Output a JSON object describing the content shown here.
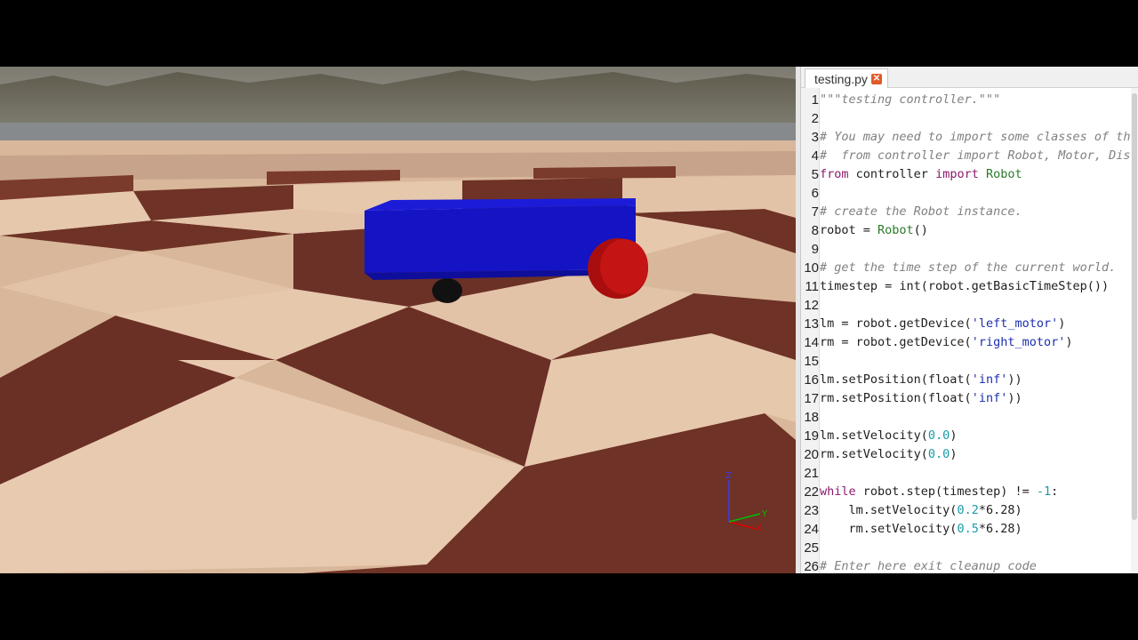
{
  "editor": {
    "tab_label": "testing.py",
    "tab_close_glyph": "✕",
    "lines": [
      {
        "n": "1",
        "tokens": [
          {
            "t": "\"\"\"testing controller.\"\"\"",
            "c": "cm"
          }
        ]
      },
      {
        "n": "2",
        "tokens": []
      },
      {
        "n": "3",
        "tokens": [
          {
            "t": "# You may need to import some classes of th",
            "c": "cm"
          }
        ]
      },
      {
        "n": "4",
        "tokens": [
          {
            "t": "#  from controller import Robot, Motor, Dis",
            "c": "cm"
          }
        ]
      },
      {
        "n": "5",
        "tokens": [
          {
            "t": "from",
            "c": "kw"
          },
          {
            "t": " controller ",
            "c": ""
          },
          {
            "t": "import",
            "c": "kw"
          },
          {
            "t": " ",
            "c": ""
          },
          {
            "t": "Robot",
            "c": "cls"
          }
        ]
      },
      {
        "n": "6",
        "tokens": []
      },
      {
        "n": "7",
        "tokens": [
          {
            "t": "# create the Robot instance.",
            "c": "cm"
          }
        ]
      },
      {
        "n": "8",
        "tokens": [
          {
            "t": "robot = ",
            "c": ""
          },
          {
            "t": "Robot",
            "c": "cls"
          },
          {
            "t": "()",
            "c": ""
          }
        ]
      },
      {
        "n": "9",
        "tokens": []
      },
      {
        "n": "10",
        "tokens": [
          {
            "t": "# get the time step of the current world.",
            "c": "cm"
          }
        ]
      },
      {
        "n": "11",
        "tokens": [
          {
            "t": "timestep = int(robot.getBasicTimeStep())",
            "c": ""
          }
        ]
      },
      {
        "n": "12",
        "tokens": []
      },
      {
        "n": "13",
        "tokens": [
          {
            "t": "lm = robot.getDevice(",
            "c": ""
          },
          {
            "t": "'left_motor'",
            "c": "str"
          },
          {
            "t": ")",
            "c": ""
          }
        ]
      },
      {
        "n": "14",
        "tokens": [
          {
            "t": "rm = robot.getDevice(",
            "c": ""
          },
          {
            "t": "'right_motor'",
            "c": "str"
          },
          {
            "t": ")",
            "c": ""
          }
        ]
      },
      {
        "n": "15",
        "tokens": []
      },
      {
        "n": "16",
        "tokens": [
          {
            "t": "lm.setPosition(float(",
            "c": ""
          },
          {
            "t": "'inf'",
            "c": "str"
          },
          {
            "t": "))",
            "c": ""
          }
        ]
      },
      {
        "n": "17",
        "tokens": [
          {
            "t": "rm.setPosition(float(",
            "c": ""
          },
          {
            "t": "'inf'",
            "c": "str"
          },
          {
            "t": "))",
            "c": ""
          }
        ]
      },
      {
        "n": "18",
        "tokens": []
      },
      {
        "n": "19",
        "tokens": [
          {
            "t": "lm.setVelocity(",
            "c": ""
          },
          {
            "t": "0.0",
            "c": "num"
          },
          {
            "t": ")",
            "c": ""
          }
        ]
      },
      {
        "n": "20",
        "tokens": [
          {
            "t": "rm.setVelocity(",
            "c": ""
          },
          {
            "t": "0.0",
            "c": "num"
          },
          {
            "t": ")",
            "c": ""
          }
        ]
      },
      {
        "n": "21",
        "tokens": []
      },
      {
        "n": "22",
        "tokens": [
          {
            "t": "while",
            "c": "kw"
          },
          {
            "t": " robot.step(timestep) != ",
            "c": ""
          },
          {
            "t": "-1",
            "c": "num"
          },
          {
            "t": ":",
            "c": ""
          }
        ]
      },
      {
        "n": "23",
        "tokens": [
          {
            "t": "    lm.setVelocity(",
            "c": ""
          },
          {
            "t": "0.2",
            "c": "num"
          },
          {
            "t": "*6.28)",
            "c": ""
          }
        ]
      },
      {
        "n": "24",
        "tokens": [
          {
            "t": "    rm.setVelocity(",
            "c": ""
          },
          {
            "t": "0.5",
            "c": "num"
          },
          {
            "t": "*6.28)",
            "c": ""
          }
        ]
      },
      {
        "n": "25",
        "tokens": []
      },
      {
        "n": "26",
        "tokens": [
          {
            "t": "# Enter here exit cleanup code",
            "c": "cm"
          }
        ]
      }
    ]
  },
  "viewport": {
    "axis_labels": {
      "z": "Z",
      "y": "Y",
      "x": "X"
    },
    "colors": {
      "robot_body": "#1010c8",
      "robot_body_top": "#1a1ad8",
      "wheel": "#b01010",
      "caster": "#111111",
      "floor_light": "#e6c6ac",
      "floor_dark": "#6b2e24",
      "sky": "#8c8a86",
      "mountains": "#6b6a5e"
    }
  }
}
